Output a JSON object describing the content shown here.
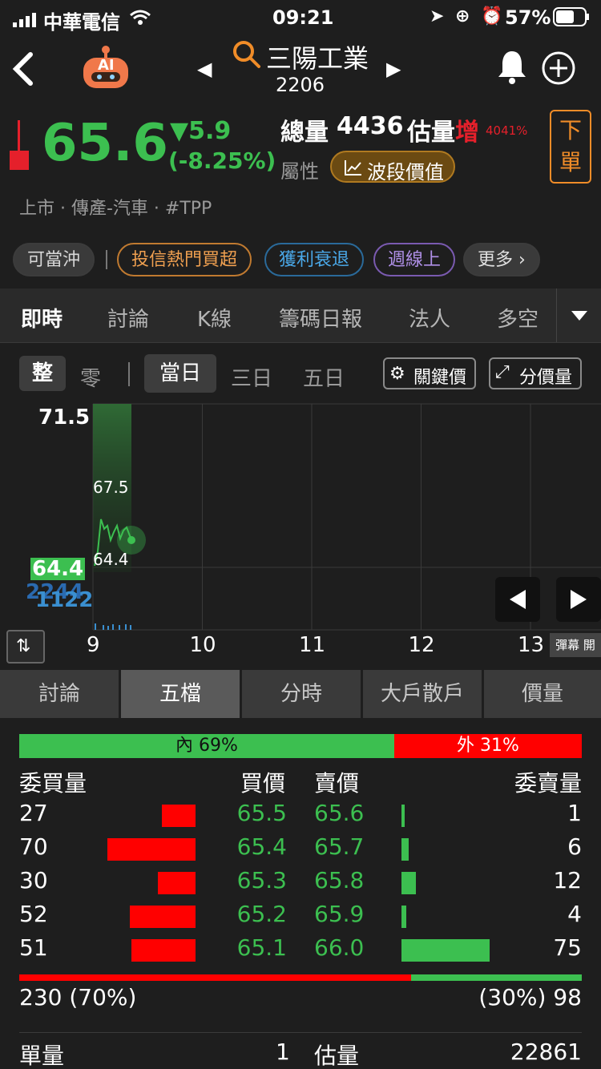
{
  "status_bar": {
    "carrier": "中華電信",
    "time": "09:21",
    "battery": "57%"
  },
  "header": {
    "stock_name": "三陽工業",
    "stock_code": "2206",
    "ai_label": "AI"
  },
  "quote": {
    "price": "65.6",
    "change": "▼5.9",
    "change_pct": "(-8.25%)",
    "volume_label": "總量",
    "volume": "4436",
    "est_label": "估量",
    "est_flag": "增",
    "est_pct": "4041%",
    "attr_label": "屬性",
    "attr_tag": "波段價值",
    "order_button": "下\n單",
    "market_info": "上市 · 傳產-汽車 · #TPP"
  },
  "tags": [
    {
      "label": "可當沖",
      "color": "#d8d8d8",
      "border": "#3c3c3c"
    },
    {
      "label": "投信熱門買超",
      "color": "#f0a050",
      "border": "#c07a30"
    },
    {
      "label": "獲利衰退",
      "color": "#4aa8e8",
      "border": "#2a6a9a"
    },
    {
      "label": "週線上",
      "color": "#b090e8",
      "border": "#7a5ab0"
    },
    {
      "label": "更多 ›",
      "color": "#e0e0e0",
      "border": "#3c3c3c"
    }
  ],
  "main_tabs": [
    "即時",
    "討論",
    "K線",
    "籌碼日報",
    "法人",
    "多空"
  ],
  "chart_controls": {
    "whole": "整",
    "odd": "零",
    "ranges": [
      "當日",
      "三日",
      "五日"
    ],
    "key_price": "關鍵價",
    "price_volume": "分價量"
  },
  "chart_data": {
    "type": "line",
    "y_max_label": "71.5",
    "current_price_label": "64.4",
    "volume_label_a": "2244",
    "volume_label_b": "1122",
    "high_label": "67.5",
    "low_label": "64.4",
    "x_ticks": [
      "9",
      "10",
      "11",
      "12",
      "13"
    ],
    "ylim": [
      57.3,
      71.5
    ],
    "danmu": "彈幕 開"
  },
  "bottom_tabs": [
    "討論",
    "五檔",
    "分時",
    "大戶散戶",
    "價量"
  ],
  "order_book": {
    "inner_label": "內 69%",
    "outer_label": "外 31%",
    "inner_pct": 69,
    "headers": {
      "bid_vol": "委買量",
      "bid": "買價",
      "ask": "賣價",
      "ask_vol": "委賣量"
    },
    "rows": [
      {
        "bid_vol": "27",
        "bid": "65.5",
        "ask": "65.6",
        "ask_vol": "1"
      },
      {
        "bid_vol": "70",
        "bid": "65.4",
        "ask": "65.7",
        "ask_vol": "6"
      },
      {
        "bid_vol": "30",
        "bid": "65.3",
        "ask": "65.8",
        "ask_vol": "12"
      },
      {
        "bid_vol": "52",
        "bid": "65.2",
        "ask": "65.9",
        "ask_vol": "4"
      },
      {
        "bid_vol": "51",
        "bid": "65.1",
        "ask": "66.0",
        "ask_vol": "75"
      }
    ],
    "bid_total": "230 (70%)",
    "ask_total": "(30%) 98",
    "bid_share": 70
  },
  "footer": {
    "single_label": "單量",
    "single_value": "1",
    "est_label": "估量",
    "est_value": "22861"
  }
}
